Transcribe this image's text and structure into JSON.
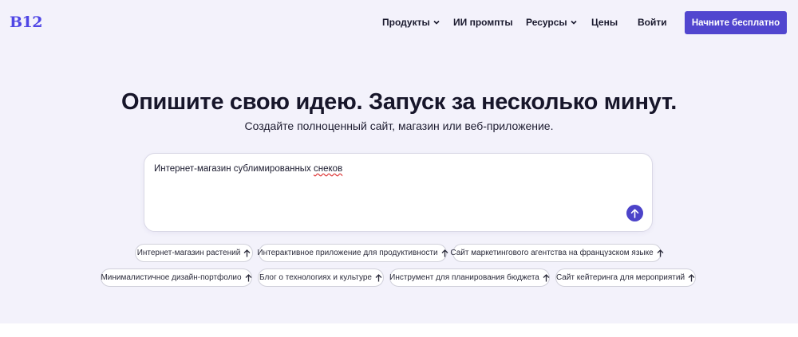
{
  "header": {
    "logo": "B12",
    "nav": [
      {
        "label": "Продукты",
        "dropdown": true
      },
      {
        "label": "ИИ промпты",
        "dropdown": false
      },
      {
        "label": "Ресурсы",
        "dropdown": true
      },
      {
        "label": "Цены",
        "dropdown": false
      },
      {
        "label": "Войти",
        "dropdown": false
      }
    ],
    "cta_label": "Начните бесплатно"
  },
  "hero": {
    "title": "Опишите свою идею. Запуск за несколько минут.",
    "subtitle": "Создайте полноценный сайт, магазин или веб-приложение.",
    "prompt": {
      "value_main": "Интернет-магазин сублимированных ",
      "value_misspelled": "снеков",
      "send_icon": "arrow-up-icon"
    },
    "suggestions_row1": [
      "Интернет-магазин растений",
      "Интерактивное приложение для продуктивности",
      "Сайт маркетингового агентства на французском языке"
    ],
    "suggestions_row2": [
      "Минималистичное дизайн-портфолио",
      "Блог о технологиях и культуре",
      "Инструмент для планирования бюджета",
      "Сайт кейтеринга для мероприятий"
    ]
  },
  "colors": {
    "accent": "#5146cf",
    "hero_bg": "#f3f2fb",
    "text": "#17162a"
  }
}
